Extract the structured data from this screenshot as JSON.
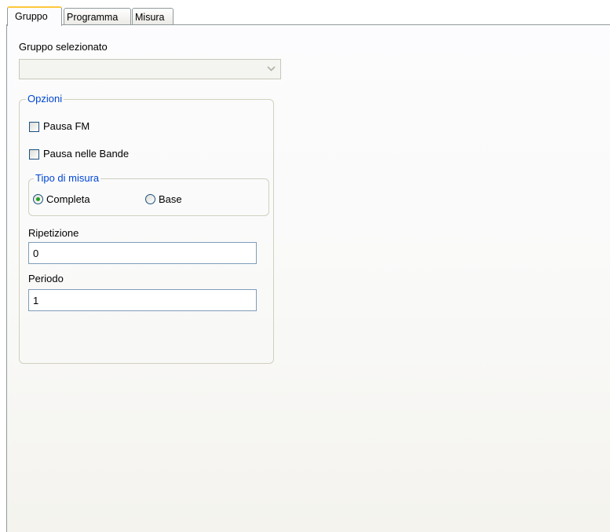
{
  "tabs": [
    {
      "label": "Gruppo",
      "active": true
    },
    {
      "label": "Programma",
      "active": false
    },
    {
      "label": "Misura",
      "active": false
    }
  ],
  "gruppo": {
    "selected_label": "Gruppo selezionato",
    "selected_value": "",
    "opzioni": {
      "title": "Opzioni",
      "pausa_fm": {
        "label": "Pausa FM",
        "checked": false
      },
      "pausa_bande": {
        "label": "Pausa nelle Bande",
        "checked": false
      },
      "tipo_misura": {
        "title": "Tipo di misura",
        "options": [
          {
            "label": "Completa",
            "selected": true
          },
          {
            "label": "Base",
            "selected": false
          }
        ]
      },
      "ripetizione": {
        "label": "Ripetizione",
        "value": "0"
      },
      "periodo": {
        "label": "Periodo",
        "value": "1"
      }
    }
  },
  "icons": {
    "combo_arrow": "chevron-down-icon"
  },
  "colors": {
    "group_title": "#0046d5",
    "active_tab_accent": "#ffc83c",
    "radio_dot": "#21a121",
    "control_border": "#1c5180",
    "textbox_border": "#7f9db9"
  }
}
